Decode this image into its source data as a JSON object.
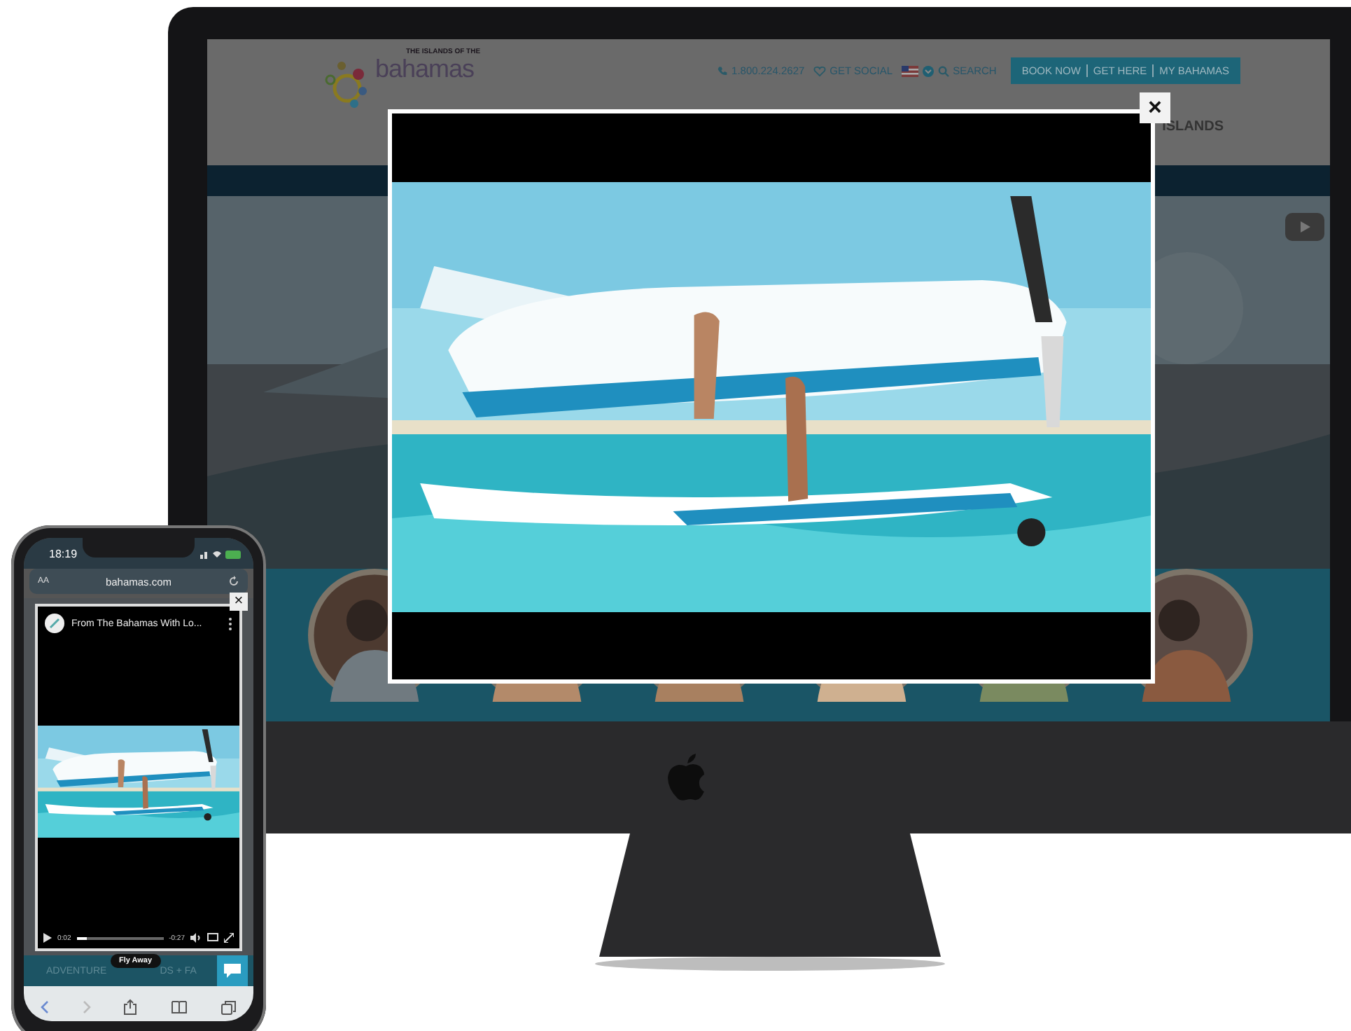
{
  "desktop": {
    "logo": {
      "tagline": "THE ISLANDS OF THE",
      "name": "bahamas"
    },
    "utility_nav": {
      "phone": "1.800.224.2627",
      "social": "GET SOCIAL",
      "search": "SEARCH"
    },
    "action_links": [
      "BOOK NOW",
      "GET HERE",
      "MY BAHAMAS"
    ],
    "menu_item": "ISLANDS",
    "video_modal": {
      "close": "×"
    }
  },
  "phone": {
    "status_bar": {
      "time": "18:19"
    },
    "address_bar": {
      "text_size": "AA",
      "url": "bahamas.com"
    },
    "video_modal": {
      "close": "×",
      "title": "From The Bahamas With Lo...",
      "elapsed": "0:02",
      "remaining": "-0:27",
      "progress": {
        "level": 0.12
      }
    },
    "section_label_start": "ADVENTURE",
    "section_label_end": "DS + FA",
    "tooltip": "Fly Away"
  }
}
